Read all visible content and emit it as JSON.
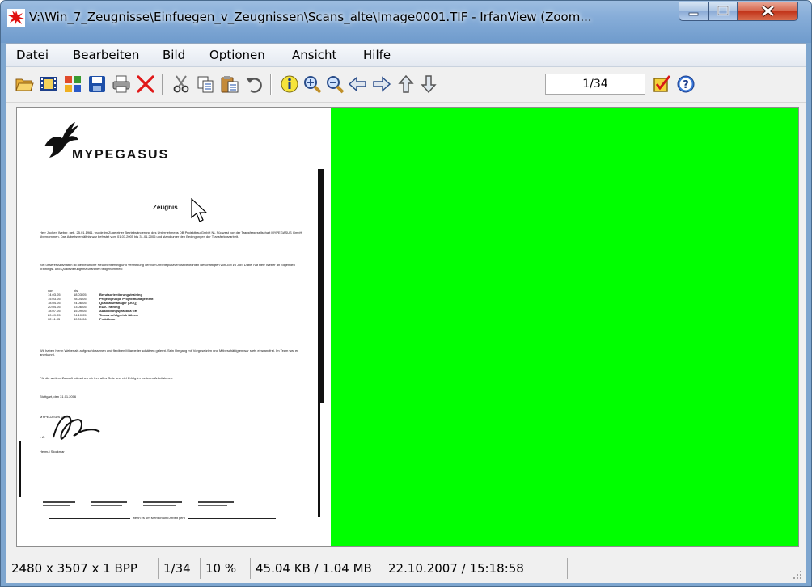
{
  "window": {
    "title": "V:\\Win_7_Zeugnisse\\Einfuegen_v_Zeugnissen\\Scans_alte\\Image0001.TIF - IrfanView (Zoom...",
    "app_icon": "irfanview-icon"
  },
  "menu": [
    {
      "label": "Datei"
    },
    {
      "label": "Bearbeiten"
    },
    {
      "label": "Bild"
    },
    {
      "label": "Optionen"
    },
    {
      "label": "Ansicht"
    },
    {
      "label": "Hilfe"
    }
  ],
  "toolbar": {
    "icons": [
      "open-folder-icon",
      "slideshow-icon",
      "thumbnails-icon",
      "save-icon",
      "print-icon",
      "delete-icon",
      "cut-icon",
      "copy-icon",
      "paste-icon",
      "undo-icon",
      "info-icon",
      "zoom-in-icon",
      "zoom-out-icon",
      "previous-icon",
      "next-icon",
      "first-page-icon",
      "last-page-icon",
      "settings-icon",
      "help-icon"
    ],
    "page_field": "1/34"
  },
  "document": {
    "logo_text": "MYPEGASUS",
    "heading": "Zeugnis",
    "para1": "Herr Jochen Weber, geb. 25.01.1961, wurde im Zuge einer Betriebsänderung des Unternehmens DB Projektbau GmbH NL Südwest von der Transfergesellschaft MYPEGASUS GmbH übernommen. Das Arbeitsverhältnis war befristet vom 01.03.2005 bis 31.01.2006 und stand unter den Bedingungen der Transferkurzarbeit.",
    "para2": "Ziel unserer Aktivitäten ist die berufliche Neuorientierung und Vermittlung der vom Arbeitsplatzverlust bedrohten Beschäftigten von Job zu Job. Dabei hat Herr Weber an folgenden Trainings- und Qualifizierungsmaßnahmen teilgenommen:",
    "table_head": [
      "von",
      "bis",
      ""
    ],
    "table_rows": [
      [
        "14.03.05",
        "18.03.05",
        "Berufsorientierungstraining"
      ],
      [
        "15.03.05",
        "28.04.05",
        "Projektgruppe Projektmanagement"
      ],
      [
        "18.04.05",
        "24.06.05",
        "Qualitätsmanager (DGQ)"
      ],
      [
        "20.04.05",
        "03.06.05",
        "EDV-Training"
      ],
      [
        "18.07.05",
        "15.09.05",
        "Ausbildungspraktika GR"
      ],
      [
        "20.09.05",
        "24.10.05",
        "Teams erfolgreich führen"
      ],
      [
        "02.11.05",
        "30.01.06",
        "Praktikum"
      ]
    ],
    "para3": "Wir haben Herrn Weber als aufgeschlossenen und flexiblen Mitarbeiter schätzen gelernt. Sein Umgang mit Vorgesetzten und Mitbeschäftigten war stets einwandfrei. Im Team war er anerkannt.",
    "para4": "Für die weitere Zukunft wünschen wir ihm alles Gute und viel Erfolg im weiteren Arbeitsleben.",
    "place_date": "Stuttgart, den 31.01.2006",
    "company": "MYPEGASUS GmbH",
    "ia": "i. A.",
    "signer": "Helmut Stockmar",
    "footer_line": "wenn es um Mensch und Arbeit geht"
  },
  "status": [
    {
      "text": "2480 x 3507 x 1 BPP"
    },
    {
      "text": "1/34"
    },
    {
      "text": "10 %"
    },
    {
      "text": "45.04 KB / 1.04 MB"
    },
    {
      "text": "22.10.2007 / 15:18:58"
    },
    {
      "text": ""
    }
  ],
  "colors": {
    "view_background": "#00ff00",
    "title_bar": "#88aed9",
    "close_button": "#c2341a"
  }
}
